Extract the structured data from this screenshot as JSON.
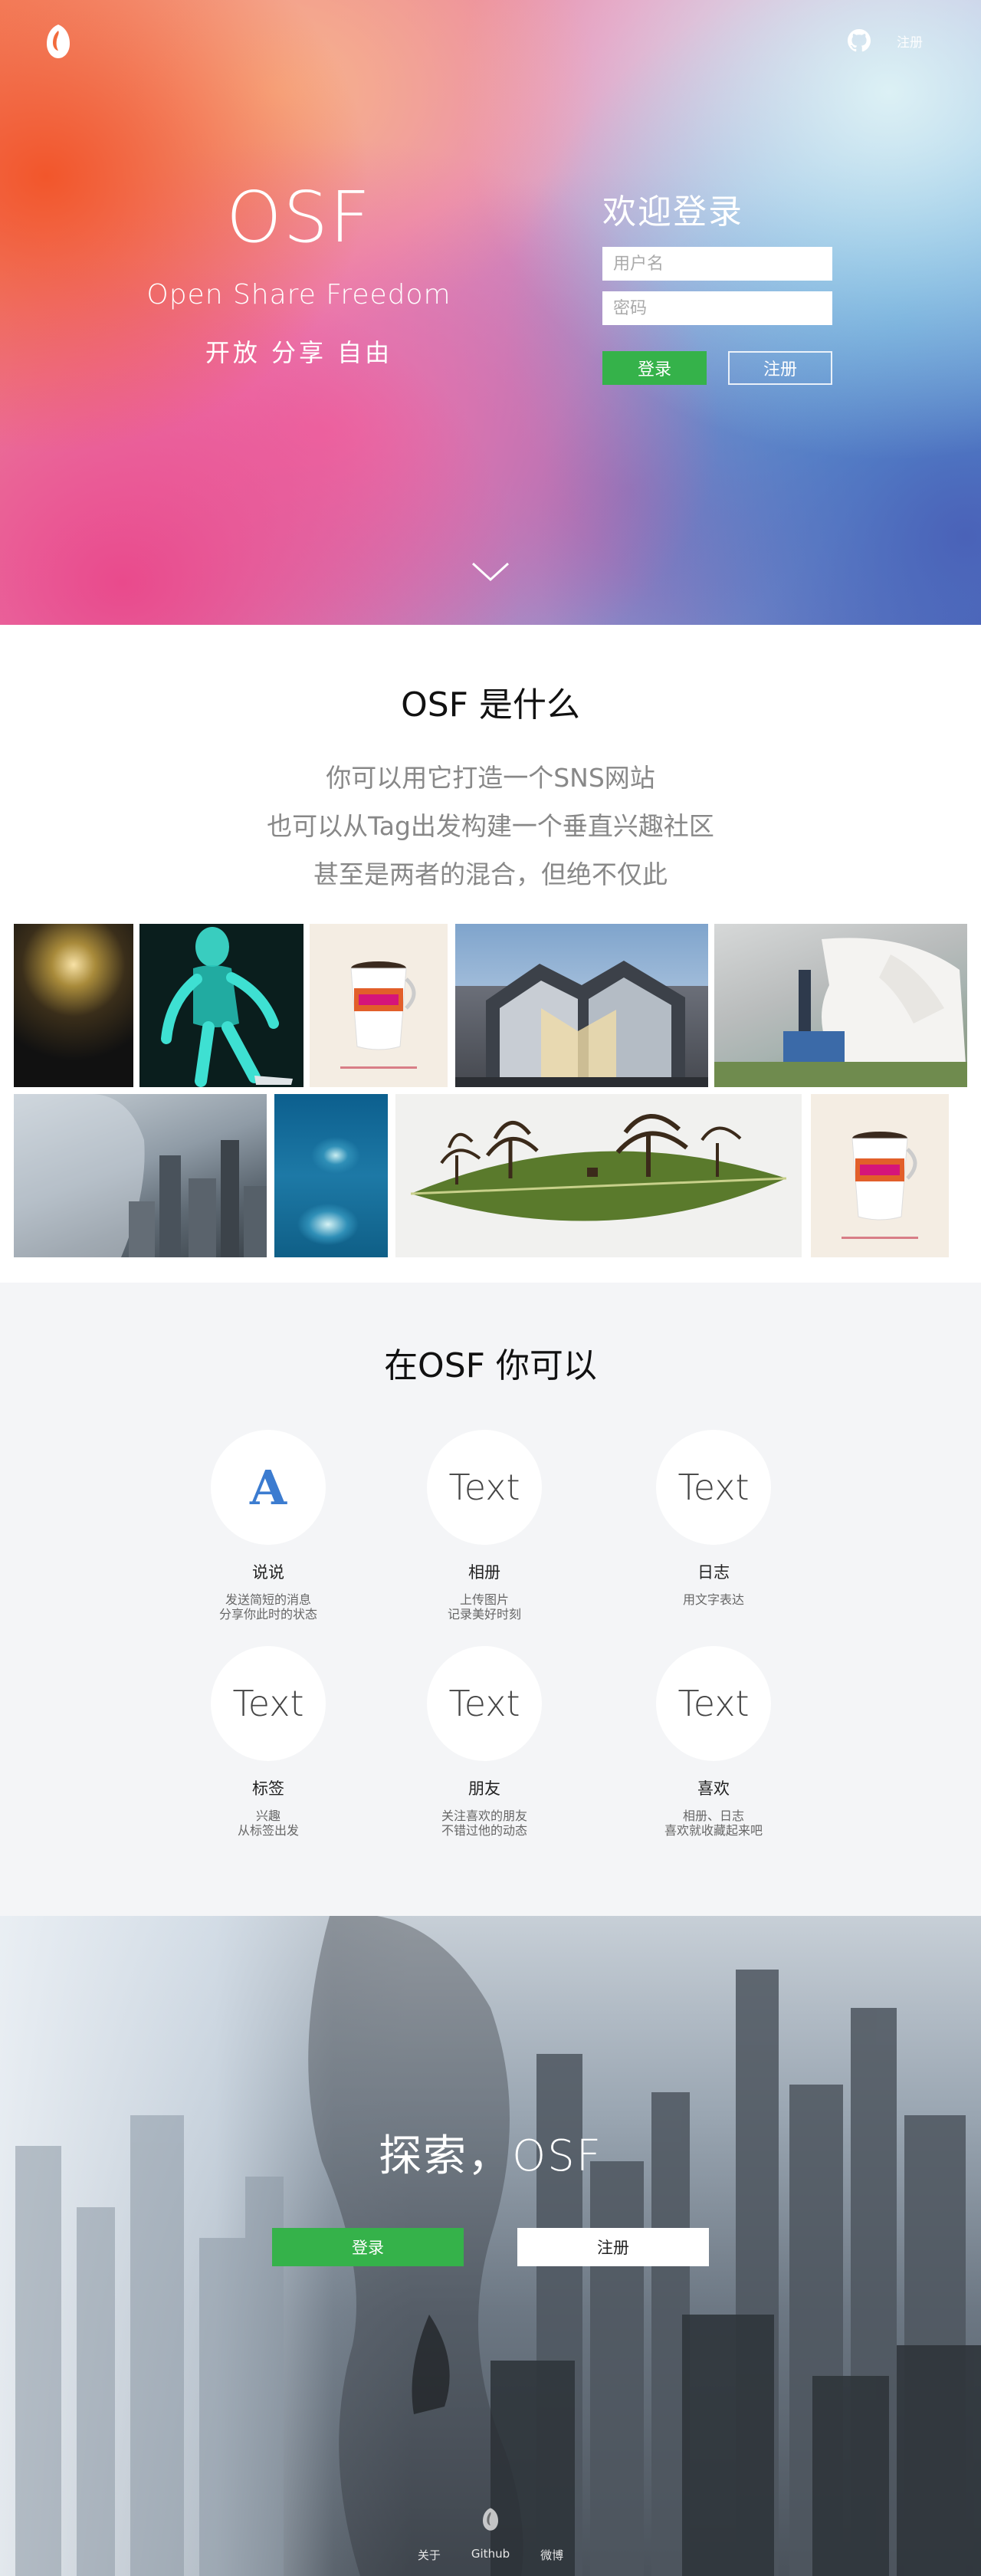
{
  "top_nav": {
    "register_link": "注册"
  },
  "hero": {
    "title": "OSF",
    "subtitle": "Open Share Freedom",
    "tagline": "开放 分享 自由"
  },
  "login": {
    "title": "欢迎登录",
    "username_placeholder": "用户名",
    "password_placeholder": "密码",
    "login_label": "登录",
    "register_label": "注册"
  },
  "about": {
    "title": "OSF 是什么",
    "lines": [
      "你可以用它打造一个SNS网站",
      "也可以从Tag出发构建一个垂直兴趣社区",
      "甚至是两者的混合，但绝不仅此"
    ]
  },
  "features": {
    "title": "在OSF 你可以",
    "items": [
      {
        "icon": "A",
        "name": "说说",
        "desc1": "发送简短的消息",
        "desc2": "分享你此时的状态"
      },
      {
        "icon": "Text",
        "name": "相册",
        "desc1": "上传图片",
        "desc2": "记录美好时刻"
      },
      {
        "icon": "Text",
        "name": "日志",
        "desc1": "用文字表达",
        "desc2": ""
      },
      {
        "icon": "Text",
        "name": "标签",
        "desc1": "兴趣",
        "desc2": "从标签出发"
      },
      {
        "icon": "Text",
        "name": "朋友",
        "desc1": "关注喜欢的朋友",
        "desc2": "不错过他的动态"
      },
      {
        "icon": "Text",
        "name": "喜欢",
        "desc1": "相册、日志",
        "desc2": "喜欢就收藏起来吧"
      }
    ]
  },
  "explore": {
    "title": "探索，OSF",
    "login_label": "登录",
    "register_label": "注册"
  },
  "footer": {
    "links": [
      "关于",
      "Github",
      "微博"
    ]
  },
  "colors": {
    "green": "#35b24a",
    "feature_a_blue": "#3c7cd0"
  }
}
